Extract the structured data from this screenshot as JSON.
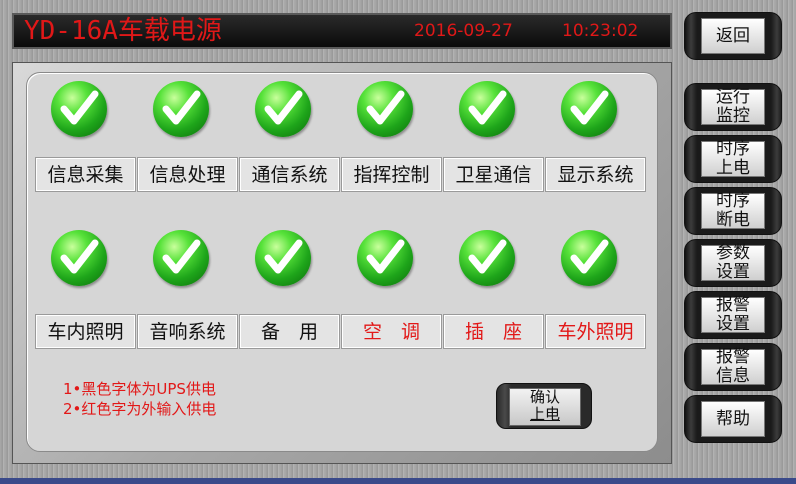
{
  "header": {
    "app_title": "YD-16A车载电源",
    "date": "2016-09-27",
    "time": "10:23:02"
  },
  "systems_row1": [
    {
      "label": "信息采集",
      "color": "black",
      "status": "ok"
    },
    {
      "label": "信息处理",
      "color": "black",
      "status": "ok"
    },
    {
      "label": "通信系统",
      "color": "black",
      "status": "ok"
    },
    {
      "label": "指挥控制",
      "color": "black",
      "status": "ok"
    },
    {
      "label": "卫星通信",
      "color": "black",
      "status": "ok"
    },
    {
      "label": "显示系统",
      "color": "black",
      "status": "ok"
    }
  ],
  "systems_row2": [
    {
      "label": "车内照明",
      "color": "black",
      "status": "ok"
    },
    {
      "label": "音响系统",
      "color": "black",
      "status": "ok"
    },
    {
      "label": "备　用",
      "color": "black",
      "status": "ok"
    },
    {
      "label": "空　调",
      "color": "red",
      "status": "ok"
    },
    {
      "label": "插　座",
      "color": "red",
      "status": "ok"
    },
    {
      "label": "车外照明",
      "color": "red",
      "status": "ok"
    }
  ],
  "notes": {
    "line1": "1•黑色字体为UPS供电",
    "line2": "2•红色字为外输入供电"
  },
  "confirm_button": {
    "line1": "确认",
    "line2": "上电"
  },
  "sidebar": [
    {
      "line1": "返回",
      "line2": ""
    },
    {
      "line1": "运行",
      "line2": "监控"
    },
    {
      "line1": "时序",
      "line2": "上电"
    },
    {
      "line1": "时序",
      "line2": "断电"
    },
    {
      "line1": "参数",
      "line2": "设置"
    },
    {
      "line1": "报警",
      "line2": "设置"
    },
    {
      "line1": "报警",
      "line2": "信息"
    },
    {
      "line1": "帮助",
      "line2": ""
    }
  ],
  "colors": {
    "red_text": "#e21818",
    "check_green": "#1ea51a"
  },
  "icons": {
    "status_ok": "check-circle-icon"
  }
}
